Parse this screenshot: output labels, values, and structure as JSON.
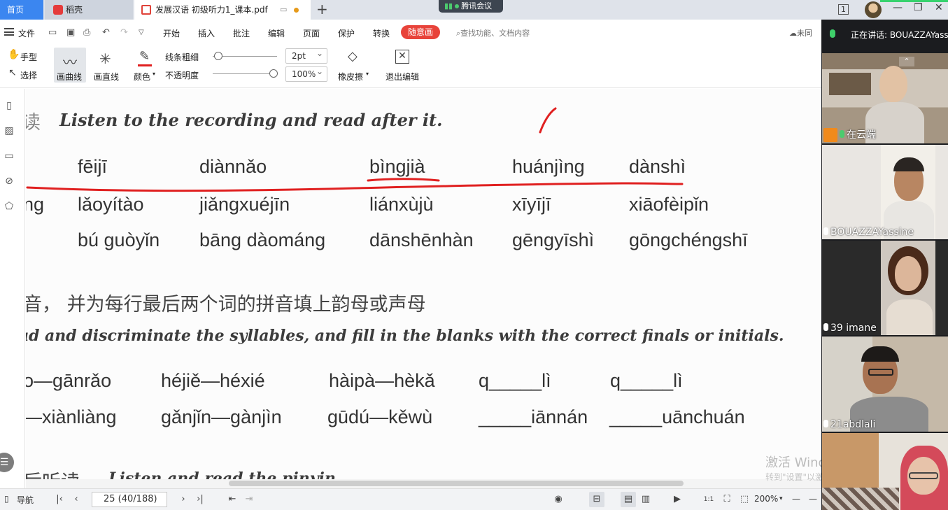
{
  "tabs": {
    "home": "首页",
    "docer": "稻壳",
    "pdf": "发展汉语 初级听力1_课本.pdf",
    "add": "+"
  },
  "meeting_pill": "腾讯会议",
  "window_controls": {
    "badge": "1",
    "minimize": "—",
    "restore": "❐",
    "close": "✕"
  },
  "menu": {
    "file": "文件",
    "items": [
      "开始",
      "插入",
      "批注",
      "编辑",
      "页面",
      "保护",
      "转换"
    ],
    "highlight": "随意画",
    "search_placeholder": "查找功能、文档内容",
    "cloud": "未同"
  },
  "toolbar": {
    "hand": "手型",
    "select": "选择",
    "draw_curve": "画曲线",
    "draw_line": "画直线",
    "color": "颜色",
    "line_thickness_label": "线条粗细",
    "opacity_label": "不透明度",
    "thickness_value": "2pt",
    "opacity_value": "100%",
    "eraser": "橡皮擦",
    "exit_edit": "退出编辑",
    "ink_color": "#e02020"
  },
  "document": {
    "instr1_prefix": "读",
    "instr1": "Listen to the recording and read after it.",
    "row1": [
      "fēijī",
      "diànnǎo",
      "bìngjià",
      "huánjìng",
      "dànshì"
    ],
    "row2_lead": "ng",
    "row2": [
      "lǎoyítào",
      "jiǎngxuéjīn",
      "liánxùjù",
      "xīyījī",
      "xiāofèipǐn"
    ],
    "row3": [
      "bú guòyǐn",
      "bāng dàománg",
      "dānshēnhàn",
      "gēngyīshì",
      "gōngchéngshī"
    ],
    "cn_instr2": "音， 并为每行最后两个词的拼音填上韵母或声母",
    "instr2": "ud and discriminate the syllables, and fill in the blanks with the correct finals or initials.",
    "pair_row1": [
      "o—gānrǎo",
      "héjiě—héxié",
      "hàipà—hèkǎ",
      "q_____lì",
      "q_____lì"
    ],
    "pair_row2": [
      "—xiànliàng",
      "gǎnjǐn—gànjìn",
      "gūdú—kěwù",
      "_____iānnán",
      "_____uānchuán"
    ],
    "bottom_cn": "后听读",
    "bottom_en": "Listen and read the pinyin."
  },
  "watermark": {
    "line1": "激活 Windows",
    "line2": "转到\"设置\"以激活 Windows。"
  },
  "statusbar": {
    "nav": "导航",
    "page": "25 (40/188)",
    "zoom": "200%"
  },
  "meeting": {
    "speaking": "正在讲话: BOUAZZAYassine",
    "participants": [
      {
        "name": "在云端",
        "host": true
      },
      {
        "name": "BOUAZZAYassine",
        "host": false
      },
      {
        "name": "39 imane",
        "host": false
      },
      {
        "name": "21abdlali",
        "host": false
      },
      {
        "name": "",
        "host": false
      }
    ]
  }
}
